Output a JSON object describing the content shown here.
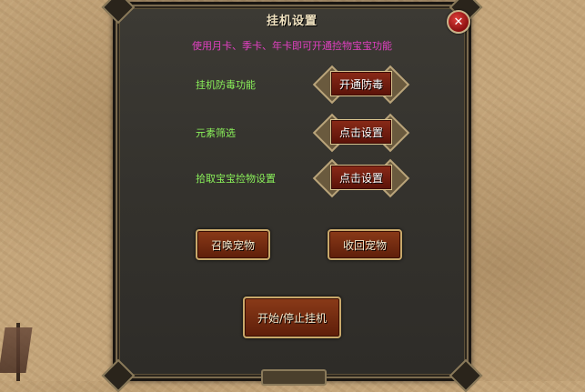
{
  "dialog": {
    "title": "挂机设置",
    "notice": "使用月卡、季卡、年卡即可开通捡物宝宝功能"
  },
  "settings": [
    {
      "label": "挂机防毒功能",
      "button": "开通防毒"
    },
    {
      "label": "元素筛选",
      "button": "点击设置"
    },
    {
      "label": "拾取宝宝捡物设置",
      "button": "点击设置"
    }
  ],
  "pet_buttons": {
    "summon": "召唤宠物",
    "recall": "收回宠物"
  },
  "start_stop": "开始/停止挂机",
  "close_symbol": "✕",
  "colors": {
    "notice": "#e040c0",
    "label": "#8af05a",
    "button_fill": "#7a2410",
    "close": "#c0201c"
  }
}
